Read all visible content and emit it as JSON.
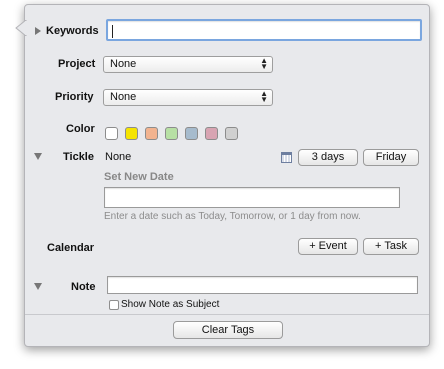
{
  "keywords": {
    "label": "Keywords",
    "value": ""
  },
  "project": {
    "label": "Project",
    "selected": "None"
  },
  "priority": {
    "label": "Priority",
    "selected": "None"
  },
  "color": {
    "label": "Color",
    "swatches": [
      "#ffffff",
      "#f5e400",
      "#f2b38f",
      "#b7e0a4",
      "#a6bbcd",
      "#d8a4b2",
      "#d0d0d0"
    ]
  },
  "tickle": {
    "label": "Tickle",
    "value": "None",
    "btn_days": "3 days",
    "btn_weekday": "Friday",
    "set_date_label": "Set New Date",
    "date_value": "",
    "hint": "Enter a date such as Today, Tomorrow, or 1 day from now."
  },
  "calendar": {
    "label": "Calendar",
    "btn_event": "+ Event",
    "btn_task": "+ Task"
  },
  "note": {
    "label": "Note",
    "value": "",
    "checkbox_label": "Show Note as Subject",
    "checked": false
  },
  "footer": {
    "clear_tags": "Clear Tags"
  }
}
